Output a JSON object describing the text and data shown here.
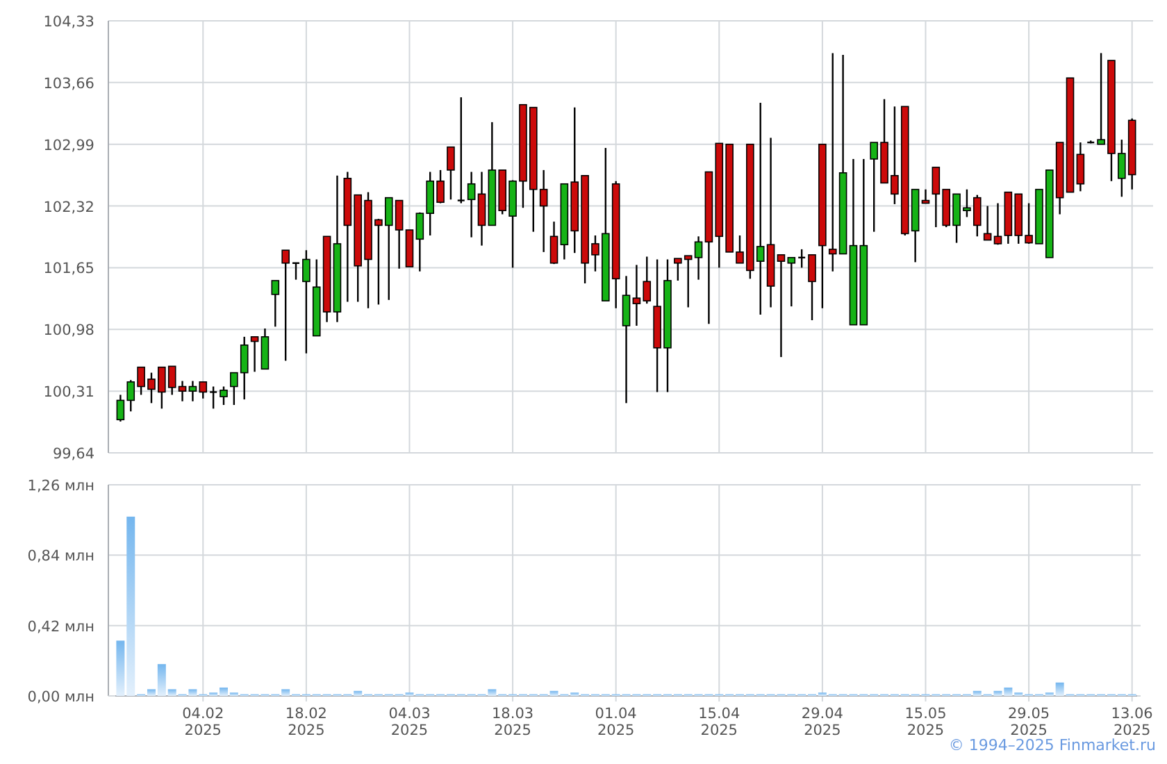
{
  "price_chart": {
    "chart_data": {
      "type": "candlestick",
      "grid": true,
      "ylim": [
        99.64,
        104.33
      ],
      "yticks": [
        {
          "value": 99.64,
          "label": "99,64"
        },
        {
          "value": 100.31,
          "label": "100,31"
        },
        {
          "value": 100.98,
          "label": "100,98"
        },
        {
          "value": 101.65,
          "label": "101,65"
        },
        {
          "value": 102.32,
          "label": "102,32"
        },
        {
          "value": 102.99,
          "label": "102,99"
        },
        {
          "value": 103.66,
          "label": "103,66"
        },
        {
          "value": 104.33,
          "label": "104,33"
        }
      ],
      "ohlc": [
        [
          100.0,
          100.27,
          99.98,
          100.21
        ],
        [
          100.21,
          100.43,
          100.09,
          100.41
        ],
        [
          100.57,
          100.57,
          100.27,
          100.36
        ],
        [
          100.44,
          100.51,
          100.18,
          100.33
        ],
        [
          100.57,
          100.57,
          100.12,
          100.3
        ],
        [
          100.58,
          100.58,
          100.27,
          100.35
        ],
        [
          100.36,
          100.42,
          100.2,
          100.31
        ],
        [
          100.31,
          100.42,
          100.2,
          100.36
        ],
        [
          100.41,
          100.41,
          100.23,
          100.3
        ],
        [
          100.3,
          100.36,
          100.12,
          100.3
        ],
        [
          100.25,
          100.36,
          100.16,
          100.32
        ],
        [
          100.36,
          100.51,
          100.16,
          100.51
        ],
        [
          100.51,
          100.9,
          100.22,
          100.81
        ],
        [
          100.9,
          100.9,
          100.52,
          100.85
        ],
        [
          100.55,
          100.99,
          100.55,
          100.9
        ],
        [
          101.36,
          101.51,
          101.01,
          101.51
        ],
        [
          101.84,
          101.84,
          100.64,
          101.7
        ],
        [
          101.7,
          101.7,
          101.52,
          101.7
        ],
        [
          101.5,
          101.84,
          100.72,
          101.74
        ],
        [
          100.91,
          101.74,
          100.91,
          101.44
        ],
        [
          101.99,
          101.99,
          101.06,
          101.17
        ],
        [
          101.17,
          102.65,
          101.06,
          101.91
        ],
        [
          102.62,
          102.69,
          101.28,
          102.11
        ],
        [
          102.44,
          102.44,
          101.28,
          101.67
        ],
        [
          102.38,
          102.47,
          101.21,
          101.74
        ],
        [
          102.17,
          102.18,
          101.25,
          102.11
        ],
        [
          102.11,
          102.41,
          101.3,
          102.41
        ],
        [
          102.38,
          102.38,
          101.64,
          102.06
        ],
        [
          102.06,
          102.06,
          101.66,
          101.66
        ],
        [
          101.96,
          102.25,
          101.61,
          102.24
        ],
        [
          102.24,
          102.69,
          102.0,
          102.59
        ],
        [
          102.59,
          102.71,
          102.35,
          102.36
        ],
        [
          102.96,
          102.96,
          102.39,
          102.71
        ],
        [
          102.38,
          103.5,
          102.35,
          102.38
        ],
        [
          102.39,
          102.69,
          101.98,
          102.56
        ],
        [
          102.45,
          102.69,
          101.89,
          102.11
        ],
        [
          102.11,
          103.23,
          102.11,
          102.71
        ],
        [
          102.71,
          102.71,
          102.23,
          102.27
        ],
        [
          102.21,
          102.6,
          101.65,
          102.59
        ],
        [
          103.42,
          103.42,
          102.3,
          102.59
        ],
        [
          103.39,
          103.39,
          102.04,
          102.5
        ],
        [
          102.5,
          102.71,
          101.82,
          102.32
        ],
        [
          101.99,
          102.15,
          101.69,
          101.7
        ],
        [
          101.9,
          102.56,
          101.74,
          102.56
        ],
        [
          102.58,
          103.39,
          101.81,
          102.05
        ],
        [
          102.65,
          102.65,
          101.48,
          101.7
        ],
        [
          101.91,
          102.0,
          101.61,
          101.79
        ],
        [
          101.29,
          102.95,
          101.29,
          102.02
        ],
        [
          102.56,
          102.59,
          101.21,
          101.53
        ],
        [
          101.02,
          101.56,
          100.18,
          101.35
        ],
        [
          101.32,
          101.68,
          101.02,
          101.26
        ],
        [
          101.5,
          101.77,
          101.26,
          101.29
        ],
        [
          101.23,
          101.74,
          100.3,
          100.78
        ],
        [
          100.78,
          101.74,
          100.3,
          101.51
        ],
        [
          101.75,
          101.75,
          101.51,
          101.7
        ],
        [
          101.78,
          101.78,
          101.22,
          101.74
        ],
        [
          101.76,
          101.99,
          101.52,
          101.93
        ],
        [
          102.69,
          102.69,
          101.04,
          101.93
        ],
        [
          103.0,
          103.0,
          101.65,
          101.99
        ],
        [
          102.99,
          102.99,
          101.82,
          101.82
        ],
        [
          101.82,
          102.0,
          101.7,
          101.7
        ],
        [
          102.99,
          102.99,
          101.53,
          101.62
        ],
        [
          101.72,
          103.44,
          101.14,
          101.88
        ],
        [
          101.9,
          103.06,
          101.22,
          101.45
        ],
        [
          101.79,
          101.79,
          100.68,
          101.72
        ],
        [
          101.7,
          101.76,
          101.23,
          101.76
        ],
        [
          101.76,
          101.85,
          101.65,
          101.76
        ],
        [
          101.79,
          101.79,
          101.08,
          101.5
        ],
        [
          102.99,
          102.99,
          101.21,
          101.89
        ],
        [
          101.85,
          103.98,
          101.61,
          101.8
        ],
        [
          101.8,
          103.96,
          101.8,
          102.68
        ],
        [
          101.03,
          102.83,
          101.03,
          101.89
        ],
        [
          101.03,
          102.83,
          101.03,
          101.89
        ],
        [
          102.83,
          103.01,
          102.04,
          103.01
        ],
        [
          103.01,
          103.48,
          102.57,
          102.57
        ],
        [
          102.65,
          103.4,
          102.34,
          102.45
        ],
        [
          103.4,
          103.4,
          102.0,
          102.02
        ],
        [
          102.05,
          102.5,
          101.71,
          102.5
        ],
        [
          102.38,
          102.5,
          102.35,
          102.35
        ],
        [
          102.74,
          102.74,
          102.09,
          102.45
        ],
        [
          102.5,
          102.5,
          102.09,
          102.11
        ],
        [
          102.11,
          102.45,
          101.92,
          102.45
        ],
        [
          102.27,
          102.5,
          102.2,
          102.3
        ],
        [
          102.41,
          102.44,
          101.99,
          102.11
        ],
        [
          102.02,
          102.32,
          101.95,
          101.95
        ],
        [
          101.99,
          102.35,
          101.9,
          101.91
        ],
        [
          102.47,
          102.47,
          101.91,
          102.0
        ],
        [
          102.45,
          102.45,
          101.91,
          102.0
        ],
        [
          102.0,
          102.35,
          101.91,
          101.92
        ],
        [
          101.91,
          102.5,
          101.91,
          102.5
        ],
        [
          101.76,
          102.71,
          101.76,
          102.71
        ],
        [
          103.01,
          103.01,
          102.23,
          102.41
        ],
        [
          103.71,
          103.71,
          102.47,
          102.47
        ],
        [
          102.88,
          103.01,
          102.48,
          102.56
        ],
        [
          103.01,
          103.03,
          103.0,
          103.01
        ],
        [
          102.99,
          103.98,
          102.99,
          103.04
        ],
        [
          103.9,
          103.9,
          102.59,
          102.89
        ],
        [
          102.62,
          103.04,
          102.42,
          102.89
        ],
        [
          103.25,
          103.27,
          102.5,
          102.66
        ]
      ]
    }
  },
  "volume_chart": {
    "x_axis_labels": [
      "04.02 2025",
      "18.02 2025",
      "04.03 2025",
      "18.03 2025",
      "01.04 2025",
      "15.04 2025",
      "29.04 2025",
      "15.05 2025",
      "29.05 2025",
      "13.06 2025"
    ],
    "chart_data": {
      "type": "bar",
      "orientation": "vertical",
      "grid": true,
      "ylim": [
        0,
        1.26
      ],
      "yticks": [
        {
          "value": 0,
          "label": "0,00 млн"
        },
        {
          "value": 0.42,
          "label": "0,42 млн"
        },
        {
          "value": 0.84,
          "label": "0,84 млн"
        },
        {
          "value": 1.26,
          "label": "1,26 млн"
        }
      ],
      "values": [
        0.33,
        1.07,
        0.01,
        0.04,
        0.19,
        0.04,
        0.01,
        0.04,
        0.01,
        0.02,
        0.05,
        0.02,
        0.01,
        0.01,
        0.01,
        0.01,
        0.04,
        0.01,
        0.01,
        0.01,
        0.01,
        0.01,
        0.01,
        0.03,
        0.01,
        0.01,
        0.01,
        0.01,
        0.02,
        0.01,
        0.01,
        0.01,
        0.01,
        0.01,
        0.01,
        0.01,
        0.04,
        0.01,
        0.01,
        0.01,
        0.01,
        0.01,
        0.03,
        0.01,
        0.02,
        0.01,
        0.01,
        0.01,
        0.01,
        0.01,
        0.01,
        0.01,
        0.01,
        0.01,
        0.01,
        0.01,
        0.01,
        0.01,
        0.01,
        0.01,
        0.01,
        0.01,
        0.01,
        0.01,
        0.01,
        0.01,
        0.01,
        0.01,
        0.02,
        0.01,
        0.01,
        0.01,
        0.01,
        0.01,
        0.01,
        0.01,
        0.01,
        0.01,
        0.01,
        0.01,
        0.01,
        0.01,
        0.01,
        0.03,
        0.01,
        0.03,
        0.05,
        0.02,
        0.01,
        0.01,
        0.02,
        0.08,
        0.01,
        0.01,
        0.01,
        0.01,
        0.01,
        0.01,
        0.01
      ]
    }
  },
  "footer": {
    "copyright": "© 1994–2025 Finmarket.ru"
  }
}
